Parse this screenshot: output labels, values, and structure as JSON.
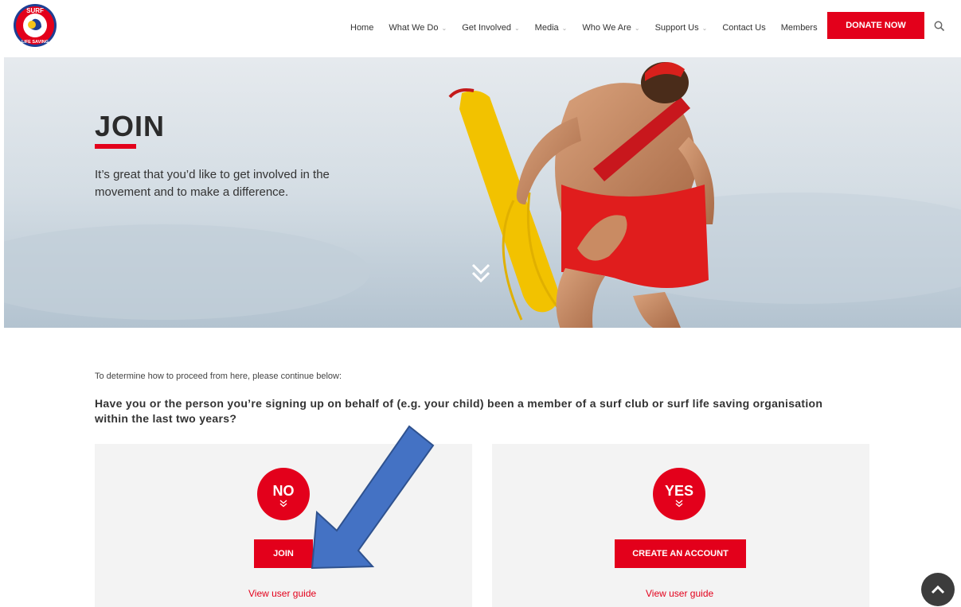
{
  "header": {
    "logo": {
      "top_text": "SURF",
      "bottom_text": "LIFE SAVING"
    },
    "nav": [
      {
        "label": "Home",
        "has_dropdown": false
      },
      {
        "label": "What We Do",
        "has_dropdown": true
      },
      {
        "label": "Get Involved",
        "has_dropdown": true
      },
      {
        "label": "Media",
        "has_dropdown": true
      },
      {
        "label": "Who We Are",
        "has_dropdown": true
      },
      {
        "label": "Support Us",
        "has_dropdown": true
      },
      {
        "label": "Contact Us",
        "has_dropdown": false
      },
      {
        "label": "Members",
        "has_dropdown": false
      }
    ],
    "caret": "⌄",
    "donate_label": "DONATE NOW",
    "search_icon": "search-icon"
  },
  "hero": {
    "title": "JOIN",
    "text": "It’s great that you’d like to get involved in the movement and to make a difference.",
    "scroll_icon": "double-chevron-down-icon"
  },
  "content": {
    "intro": "To determine how to proceed from here, please continue  below:",
    "question": "Have you or the person you’re signing up on behalf of (e.g. your child) been a member of a surf club or surf life saving organisation within the last two years?",
    "cards": [
      {
        "badge": "NO",
        "button": "JOIN",
        "link": "View user guide"
      },
      {
        "badge": "YES",
        "button": "CREATE AN ACCOUNT",
        "link": "View user guide"
      }
    ]
  },
  "colors": {
    "accent": "#e3001b",
    "annotation_arrow": "#4472c4",
    "card_bg": "#f3f3f3"
  },
  "back_to_top_icon": "chevron-up-icon"
}
